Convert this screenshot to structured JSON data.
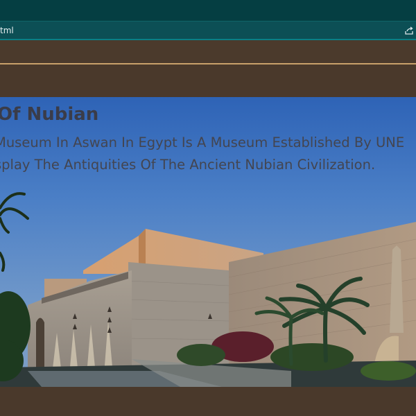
{
  "browser": {
    "url_fragment": "tml",
    "share_icon": "share-icon"
  },
  "hero": {
    "title": "Of Nubian",
    "description_line1": "Museum In Aswan In Egypt Is A Museum Established By UNE",
    "description_line2": "splay The Antiquities Of The Ancient Nubian Civilization."
  },
  "colors": {
    "top_bar": "#053e42",
    "address_bar": "#0c4f55",
    "brown_band": "#4b3a2c",
    "accent_rule": "#c9a16a"
  }
}
